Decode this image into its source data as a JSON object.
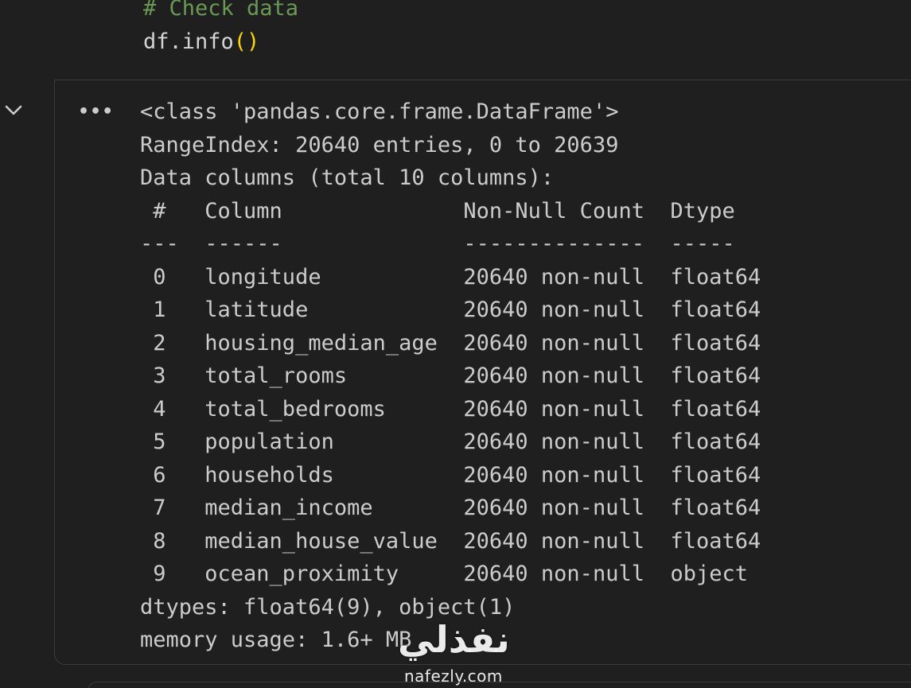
{
  "code": {
    "comment": "# Check data",
    "call_name": "df.info",
    "call_parens": "()"
  },
  "output": {
    "menu_label": "•••",
    "lines": [
      "<class 'pandas.core.frame.DataFrame'>",
      "RangeIndex: 20640 entries, 0 to 20639",
      "Data columns (total 10 columns):",
      " #   Column              Non-Null Count  Dtype  ",
      "---  ------              --------------  -----  ",
      " 0   longitude           20640 non-null  float64",
      " 1   latitude            20640 non-null  float64",
      " 2   housing_median_age  20640 non-null  float64",
      " 3   total_rooms         20640 non-null  float64",
      " 4   total_bedrooms      20640 non-null  float64",
      " 5   population          20640 non-null  float64",
      " 6   households          20640 non-null  float64",
      " 7   median_income       20640 non-null  float64",
      " 8   median_house_value  20640 non-null  float64",
      " 9   ocean_proximity     20640 non-null  object ",
      "dtypes: float64(9), object(1)",
      "memory usage: 1.6+ MB"
    ]
  },
  "watermark": {
    "arabic": "نفذلي",
    "latin": "nafezly.com"
  },
  "icons": {
    "collapse": "chevron-down-icon",
    "menu": "more-horizontal-icon"
  }
}
